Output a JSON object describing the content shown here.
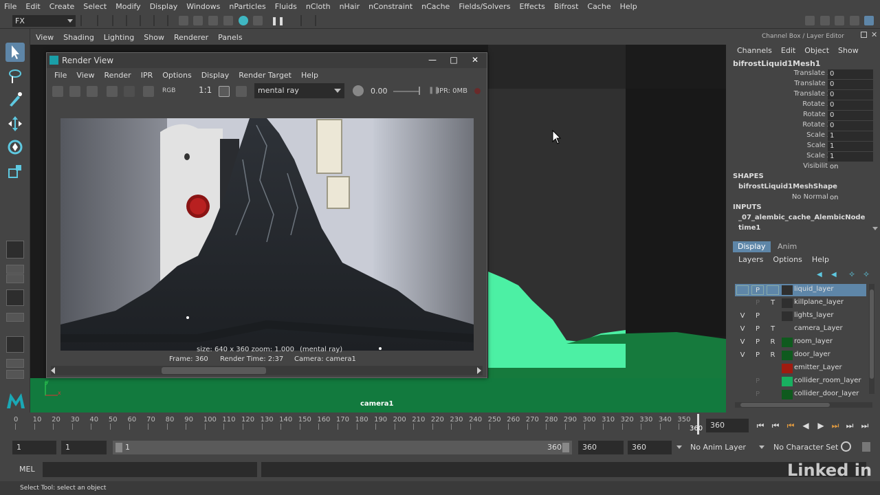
{
  "menubar": [
    "File",
    "Edit",
    "Create",
    "Select",
    "Modify",
    "Display",
    "Windows",
    "nParticles",
    "Fluids",
    "nCloth",
    "nHair",
    "nConstraint",
    "nCache",
    "Fields/Solvers",
    "Effects",
    "Bifrost",
    "Cache",
    "Help"
  ],
  "mode_selector": "FX",
  "viewport": {
    "menu": [
      "View",
      "Shading",
      "Lighting",
      "Show",
      "Renderer",
      "Panels"
    ],
    "camera_label": "camera1",
    "axis_y": "y",
    "axis_x": "x"
  },
  "render_view": {
    "title": "Render View",
    "menu": [
      "File",
      "View",
      "Render",
      "IPR",
      "Options",
      "Display",
      "Render Target",
      "Help"
    ],
    "ratio_label": "1:1",
    "rgb_label": "RGB",
    "renderer": "mental ray",
    "exposure": "0.00",
    "ipr_mem": "IPR: 0MB",
    "caption": "size: 640 x 360 zoom: 1.000",
    "caption_renderer": "(mental ray)",
    "frame": "Frame: 360",
    "render_time": "Render Time: 2:37",
    "camera": "Camera: camera1"
  },
  "channel_box": {
    "title": "Channel Box / Layer Editor",
    "menu": [
      "Channels",
      "Edit",
      "Object",
      "Show"
    ],
    "object": "bifrostLiquid1Mesh1",
    "attrs": [
      {
        "name": "Translate X",
        "value": "0"
      },
      {
        "name": "Translate Y",
        "value": "0"
      },
      {
        "name": "Translate Z",
        "value": "0"
      },
      {
        "name": "Rotate X",
        "value": "0"
      },
      {
        "name": "Rotate Y",
        "value": "0"
      },
      {
        "name": "Rotate Z",
        "value": "0"
      },
      {
        "name": "Scale X",
        "value": "1"
      },
      {
        "name": "Scale Y",
        "value": "1"
      },
      {
        "name": "Scale Z",
        "value": "1"
      },
      {
        "name": "Visibility",
        "value": "on"
      }
    ],
    "shapes_label": "SHAPES",
    "shape_node": "bifrostLiquid1MeshShape",
    "shape_attr": {
      "name": "No Normals",
      "value": "on"
    },
    "inputs_label": "INPUTS",
    "input_nodes": [
      "_07_alembic_cache_AlembicNode",
      "time1"
    ]
  },
  "layer_editor": {
    "tabs": [
      "Display",
      "Anim"
    ],
    "menu": [
      "Layers",
      "Options",
      "Help"
    ],
    "layers": [
      {
        "v": "",
        "p": "P",
        "t": "",
        "name": "liquid_layer",
        "color": "#2f2f2f"
      },
      {
        "v": "",
        "p": "P",
        "t": "T",
        "name": "killplane_layer",
        "color": "#2f2f2f"
      },
      {
        "v": "V",
        "p": "P",
        "t": "",
        "name": "lights_layer",
        "color": "#2f2f2f"
      },
      {
        "v": "V",
        "p": "P",
        "t": "T",
        "name": "camera_Layer",
        "color": "#444444"
      },
      {
        "v": "V",
        "p": "P",
        "t": "R",
        "name": "room_layer",
        "color": "#0f5a1e"
      },
      {
        "v": "V",
        "p": "P",
        "t": "R",
        "name": "door_layer",
        "color": "#0f5a1e"
      },
      {
        "v": "",
        "p": "",
        "t": "",
        "name": "emitter_Layer",
        "color": "#a01b10"
      },
      {
        "v": "",
        "p": "P",
        "t": "",
        "name": "collider_room_layer",
        "color": "#18b060"
      },
      {
        "v": "",
        "p": "P",
        "t": "",
        "name": "collider_door_layer",
        "color": "#0f5a1e"
      }
    ]
  },
  "timeline": {
    "ticks": [
      0,
      10,
      20,
      30,
      40,
      50,
      60,
      70,
      80,
      90,
      100,
      110,
      120,
      130,
      140,
      150,
      160,
      170,
      180,
      190,
      200,
      210,
      220,
      230,
      240,
      250,
      260,
      270,
      280,
      290,
      300,
      310,
      320,
      330,
      340,
      350
    ],
    "current_marker": "360",
    "current_frame": "360"
  },
  "range": {
    "start": "1",
    "playback_start": "1",
    "slider_start": "1",
    "slider_end": "360",
    "playback_end": "360",
    "end": "360",
    "anim_layer": "No Anim Layer",
    "character_set": "No Character Set"
  },
  "command_line": {
    "label": "MEL"
  },
  "help_line": "Select Tool: select an object",
  "watermark": "Linked in"
}
